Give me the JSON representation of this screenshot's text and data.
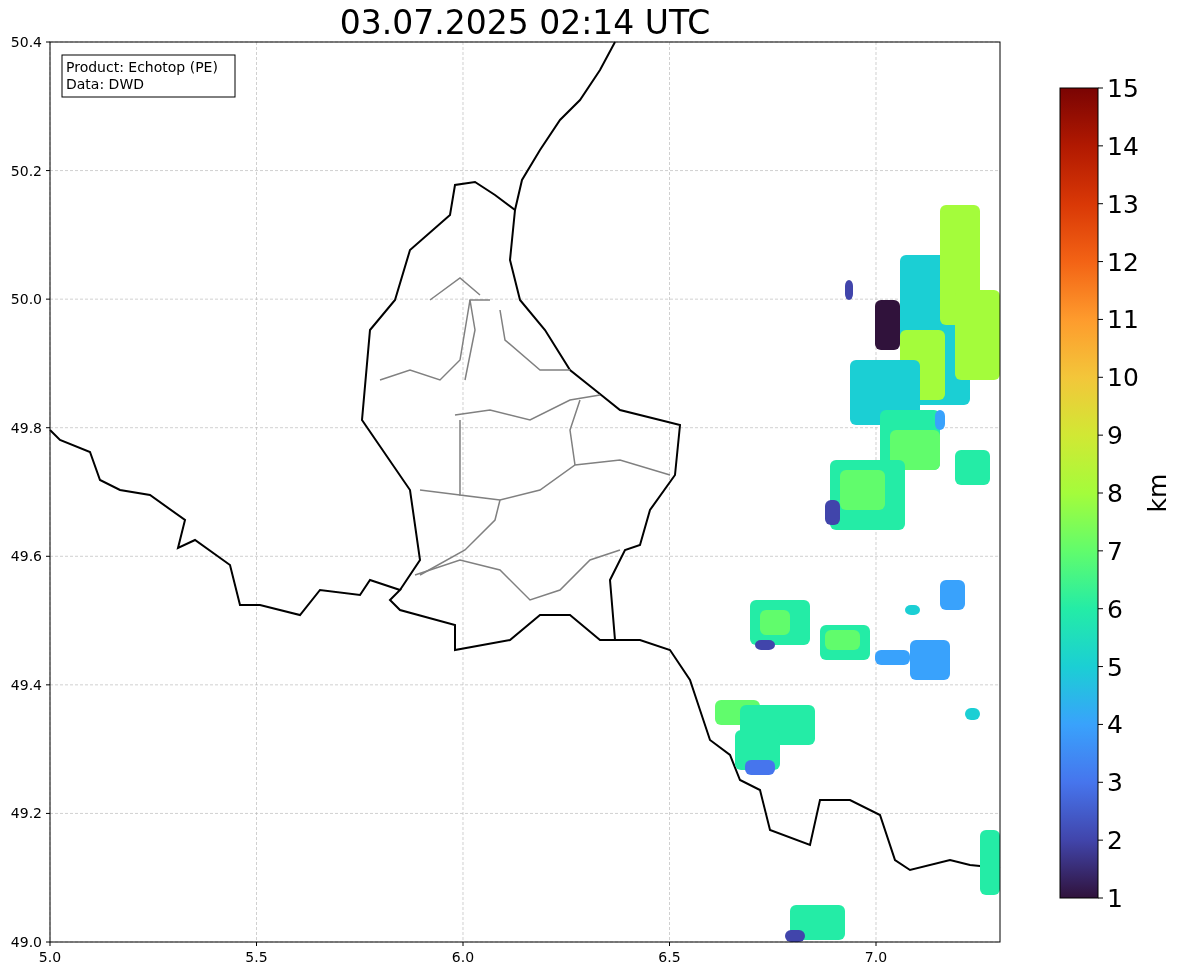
{
  "title": "03.07.2025 02:14 UTC",
  "info_box": [
    "Product: Echotop (PE)",
    "Data: DWD"
  ],
  "x_ticks": [
    "5.0",
    "5.5",
    "6.0",
    "6.5",
    "7.0"
  ],
  "y_ticks": [
    "50.4",
    "50.2",
    "50.0",
    "49.8",
    "49.6",
    "49.4",
    "49.2",
    "49.0"
  ],
  "colorbar": {
    "label": "km",
    "ticks": [
      "15",
      "14",
      "13",
      "12",
      "11",
      "10",
      "9",
      "8",
      "7",
      "6",
      "5",
      "4",
      "3",
      "2",
      "1"
    ]
  }
}
